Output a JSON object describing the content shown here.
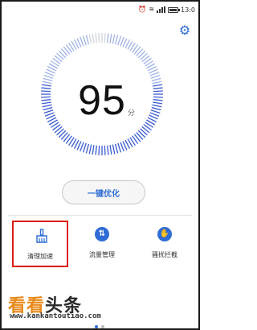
{
  "status_bar": {
    "time": "13:0",
    "icons": [
      "alarm-icon",
      "wifi-icon",
      "signal-icon",
      "battery-icon"
    ]
  },
  "settings": {
    "icon": "gear-icon"
  },
  "dial": {
    "score": "95",
    "unit": "分",
    "progress": 0.95
  },
  "optimize": {
    "label": "一键优化"
  },
  "tools": [
    {
      "label": "清理加速",
      "icon": "broom-icon"
    },
    {
      "label": "流量管理",
      "icon": "traffic-icon"
    },
    {
      "label": "骚扰拦截",
      "icon": "hand-block-icon"
    }
  ],
  "watermark": {
    "text_a": "看看",
    "text_b": "头条",
    "url": "www.kankantoutiao.com"
  },
  "colors": {
    "accent": "#2f6dd6",
    "tick_inactive": "#d0d4da",
    "highlight_box": "#d91e18",
    "watermark_orange": "#e88a1a"
  },
  "pager": {
    "count": 2,
    "active": 0
  }
}
